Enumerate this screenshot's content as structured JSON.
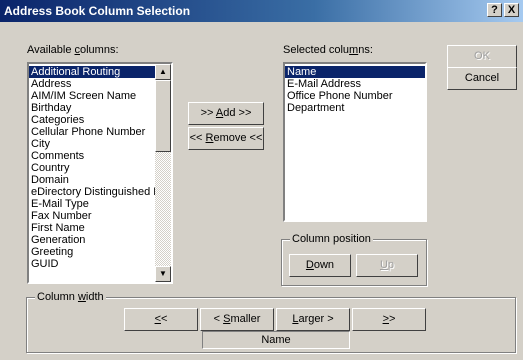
{
  "window": {
    "title": "Address Book Column Selection",
    "help_label": "?",
    "close_label": "X"
  },
  "available": {
    "label_pre": "Available ",
    "label_key": "c",
    "label_post": "olumns:",
    "items": [
      "Additional Routing",
      "Address",
      "AIM/IM Screen Name",
      "Birthday",
      "Categories",
      "Cellular Phone Number",
      "City",
      "Comments",
      "Country",
      "Domain",
      "eDirectory Distinguished Na",
      "E-Mail Type",
      "Fax Number",
      "First Name",
      "Generation",
      "Greeting",
      "GUID"
    ],
    "selected_index": 0
  },
  "selected": {
    "label_pre": "Selected colu",
    "label_key": "m",
    "label_post": "ns:",
    "items": [
      "Name",
      "E-Mail Address",
      "Office Phone Number",
      "Department"
    ],
    "selected_index": 0
  },
  "buttons": {
    "ok": "OK",
    "cancel": "Cancel",
    "add_pre": ">> ",
    "add_key": "A",
    "add_post": "dd >>",
    "remove_pre": "<< ",
    "remove_key": "R",
    "remove_post": "emove <<"
  },
  "column_position": {
    "title": "Column position",
    "down_key": "D",
    "down_post": "own",
    "up_key": "U",
    "up_post": "p"
  },
  "column_width": {
    "title_pre": "Column ",
    "title_key": "w",
    "title_post": "idth",
    "min_key": "<",
    "min_post": "<",
    "smaller_pre": "< ",
    "smaller_key": "S",
    "smaller_post": "maller",
    "larger_key": "L",
    "larger_post": "arger >",
    "max_key": ">",
    "max_post": ">",
    "current_column": "Name"
  },
  "icons": {
    "scroll_up": "scroll-up-arrow-icon",
    "scroll_down": "scroll-down-arrow-icon"
  },
  "colors": {
    "title_bar": "#0a246a",
    "dialog_bg": "#d4d0c8",
    "selection": "#0a246a"
  }
}
